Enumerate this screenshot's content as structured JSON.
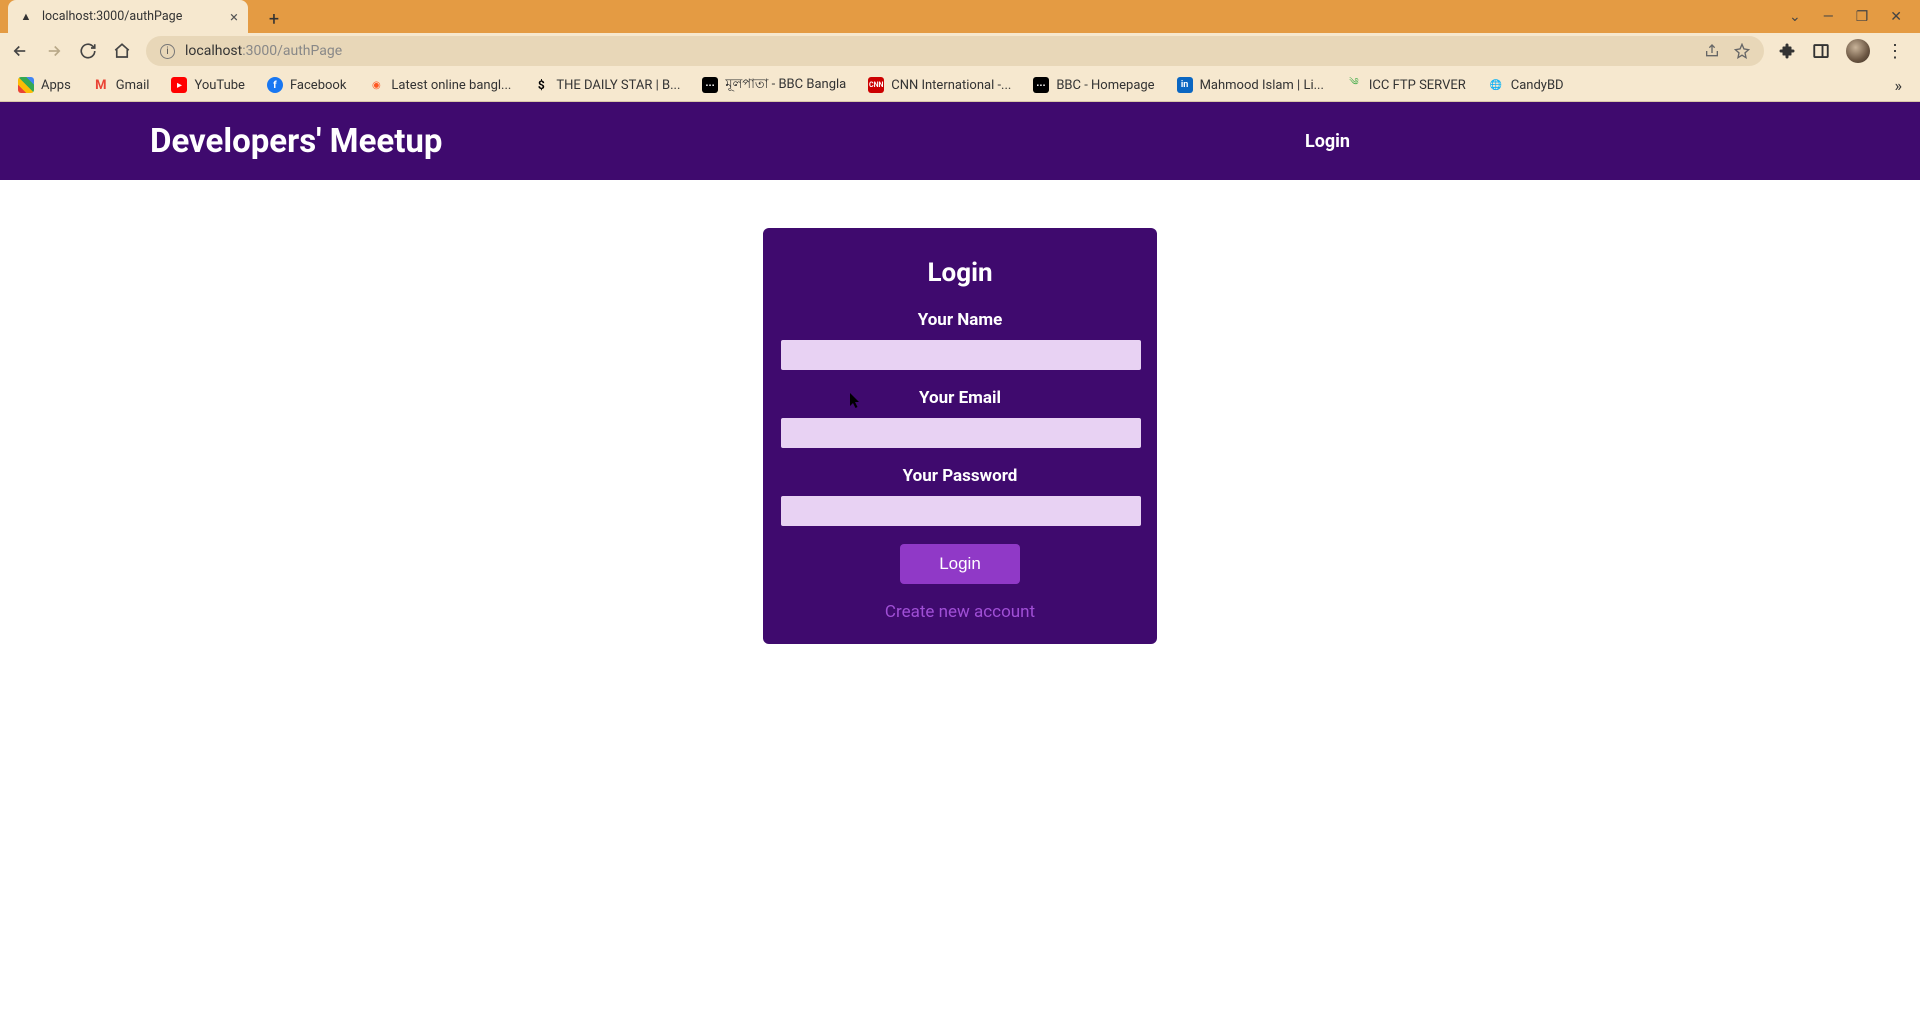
{
  "browser": {
    "tab": {
      "title": "localhost:3000/authPage",
      "favicon": "▲"
    },
    "url": {
      "host": "localhost",
      "port_path": ":3000/authPage"
    },
    "window_controls": {
      "minimize": "—",
      "maximize": "❐",
      "close": "✕"
    }
  },
  "bookmarks": [
    {
      "label": "Apps",
      "color": "transparent",
      "text_icon": "⠿"
    },
    {
      "label": "Gmail",
      "color": "transparent",
      "text_icon": "M"
    },
    {
      "label": "YouTube",
      "color": "#ff0000",
      "text_icon": "▶"
    },
    {
      "label": "Facebook",
      "color": "#1877f2",
      "text_icon": "f"
    },
    {
      "label": "Latest online bangl...",
      "color": "#ff5722",
      "text_icon": "◐"
    },
    {
      "label": "THE DAILY STAR | B...",
      "color": "#000",
      "text_icon": "S"
    },
    {
      "label": "মূলপাতা - BBC Bangla",
      "color": "#000",
      "text_icon": "▪▪▪"
    },
    {
      "label": "CNN International -...",
      "color": "#cc0000",
      "text_icon": "CNN"
    },
    {
      "label": "BBC - Homepage",
      "color": "#000",
      "text_icon": "▪▪▪"
    },
    {
      "label": "Mahmood Islam | Li...",
      "color": "#0a66c2",
      "text_icon": "in"
    },
    {
      "label": "ICC FTP SERVER",
      "color": "#4caf50",
      "text_icon": "༄"
    },
    {
      "label": "CandyBD",
      "color": "#333",
      "text_icon": "🌐"
    }
  ],
  "header": {
    "brand": "Developers' Meetup",
    "login": "Login"
  },
  "form": {
    "title": "Login",
    "name_label": "Your Name",
    "email_label": "Your Email",
    "password_label": "Your Password",
    "name_value": "",
    "email_value": "",
    "password_value": "",
    "submit_label": "Login",
    "create_link": "Create new account"
  }
}
